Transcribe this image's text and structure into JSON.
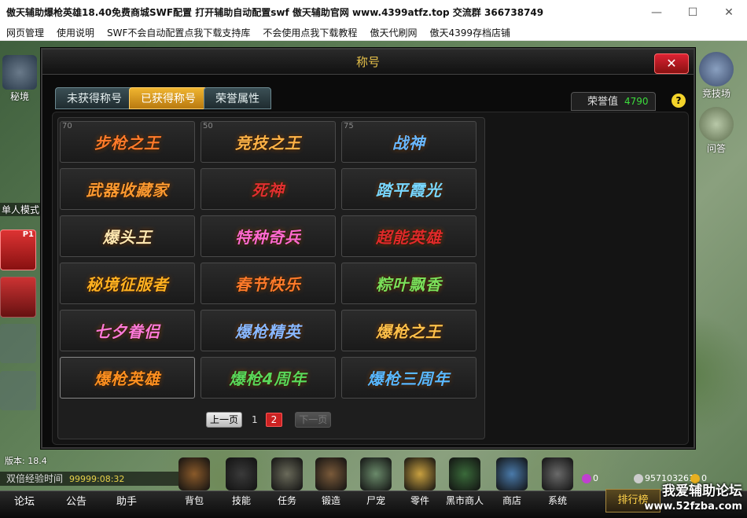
{
  "window": {
    "title": "傲天辅助爆枪英雄18.40免费商城SWF配置  打开辅助自动配置swf 傲天辅助官网 www.4399atfz.top 交流群 366738749",
    "minimize": "—",
    "maximize": "☐",
    "close": "✕"
  },
  "menu": [
    "网页管理",
    "使用说明",
    "SWF不会自动配置点我下载支持库",
    "不会使用点我下载教程",
    "傲天代刷网",
    "傲天4399存档店铺"
  ],
  "left_side": {
    "secret": "秘境",
    "single_mode": "单人模式",
    "p1": "P1"
  },
  "right_side": {
    "arena": "竞技场",
    "quiz": "问答"
  },
  "dialog": {
    "title": "称号",
    "close_label": "✕",
    "tabs": [
      "未获得称号",
      "已获得称号",
      "荣誉属性"
    ],
    "active_tab": 1,
    "honor_label": "荣誉值",
    "honor_value": "4790",
    "help": "?",
    "titles": [
      {
        "level": "70",
        "name": "步枪之王",
        "color": "#ff7a2a"
      },
      {
        "level": "50",
        "name": "竞技之王",
        "color": "#ffb347"
      },
      {
        "level": "75",
        "name": "战神",
        "color": "#6ab8ff"
      },
      {
        "level": "",
        "name": "武器收藏家",
        "color": "#ff9a30"
      },
      {
        "level": "",
        "name": "死神",
        "color": "#e03030"
      },
      {
        "level": "",
        "name": "踏平霞光",
        "color": "#7ad8ff"
      },
      {
        "level": "",
        "name": "爆头王",
        "color": "#ffe7b0"
      },
      {
        "level": "",
        "name": "特种奇兵",
        "color": "#ff6ad0"
      },
      {
        "level": "",
        "name": "超能英雄",
        "color": "#e02a2a"
      },
      {
        "level": "",
        "name": "秘境征服者",
        "color": "#ffb020"
      },
      {
        "level": "",
        "name": "春节快乐",
        "color": "#ff7a2a"
      },
      {
        "level": "",
        "name": "粽叶飘香",
        "color": "#7ae05a"
      },
      {
        "level": "",
        "name": "七夕眷侣",
        "color": "#ff7ad8"
      },
      {
        "level": "",
        "name": "爆枪精英",
        "color": "#8ab8ff"
      },
      {
        "level": "",
        "name": "爆枪之王",
        "color": "#ffc04a"
      },
      {
        "level": "",
        "name": "爆枪英雄",
        "color": "#ff9020"
      },
      {
        "level": "",
        "name": "爆枪4周年",
        "color": "#5ad85a"
      },
      {
        "level": "",
        "name": "爆枪三周年",
        "color": "#5ab8ff"
      }
    ],
    "pager": {
      "prev": "上一页",
      "pages": [
        "1",
        "2"
      ],
      "current": "2",
      "next": "下一页"
    }
  },
  "status": {
    "version": "版本: 18.4",
    "exp_label": "双倍经验时间",
    "exp_value": "99999:08:32"
  },
  "bottom_left": [
    "论坛",
    "公告",
    "助手"
  ],
  "toolbar": [
    {
      "label": "背包",
      "icon": "backpack-icon",
      "color": "#8a5a2a"
    },
    {
      "label": "技能",
      "icon": "skill-icon",
      "color": "#3a3a3a"
    },
    {
      "label": "任务",
      "icon": "scroll-icon",
      "color": "#6a6a5a"
    },
    {
      "label": "锻造",
      "icon": "hammer-icon",
      "color": "#7a5a3a"
    },
    {
      "label": "尸宠",
      "icon": "zombie-icon",
      "color": "#6a8a6a"
    },
    {
      "label": "零件",
      "icon": "bullet-icon",
      "color": "#c8a040"
    },
    {
      "label": "黑市商人",
      "icon": "merchant-icon",
      "color": "#3a6a3a"
    },
    {
      "label": "商店",
      "icon": "shop-icon",
      "color": "#4a7aaa"
    },
    {
      "label": "系统",
      "icon": "gear-icon",
      "color": "#6a6a6a"
    }
  ],
  "resources": {
    "gem": "0",
    "silver": "957103261",
    "gold": "0"
  },
  "rank_label": "排行榜",
  "watermark": {
    "line1": "我爱辅助论坛",
    "line2": "www.52fzba.com"
  }
}
